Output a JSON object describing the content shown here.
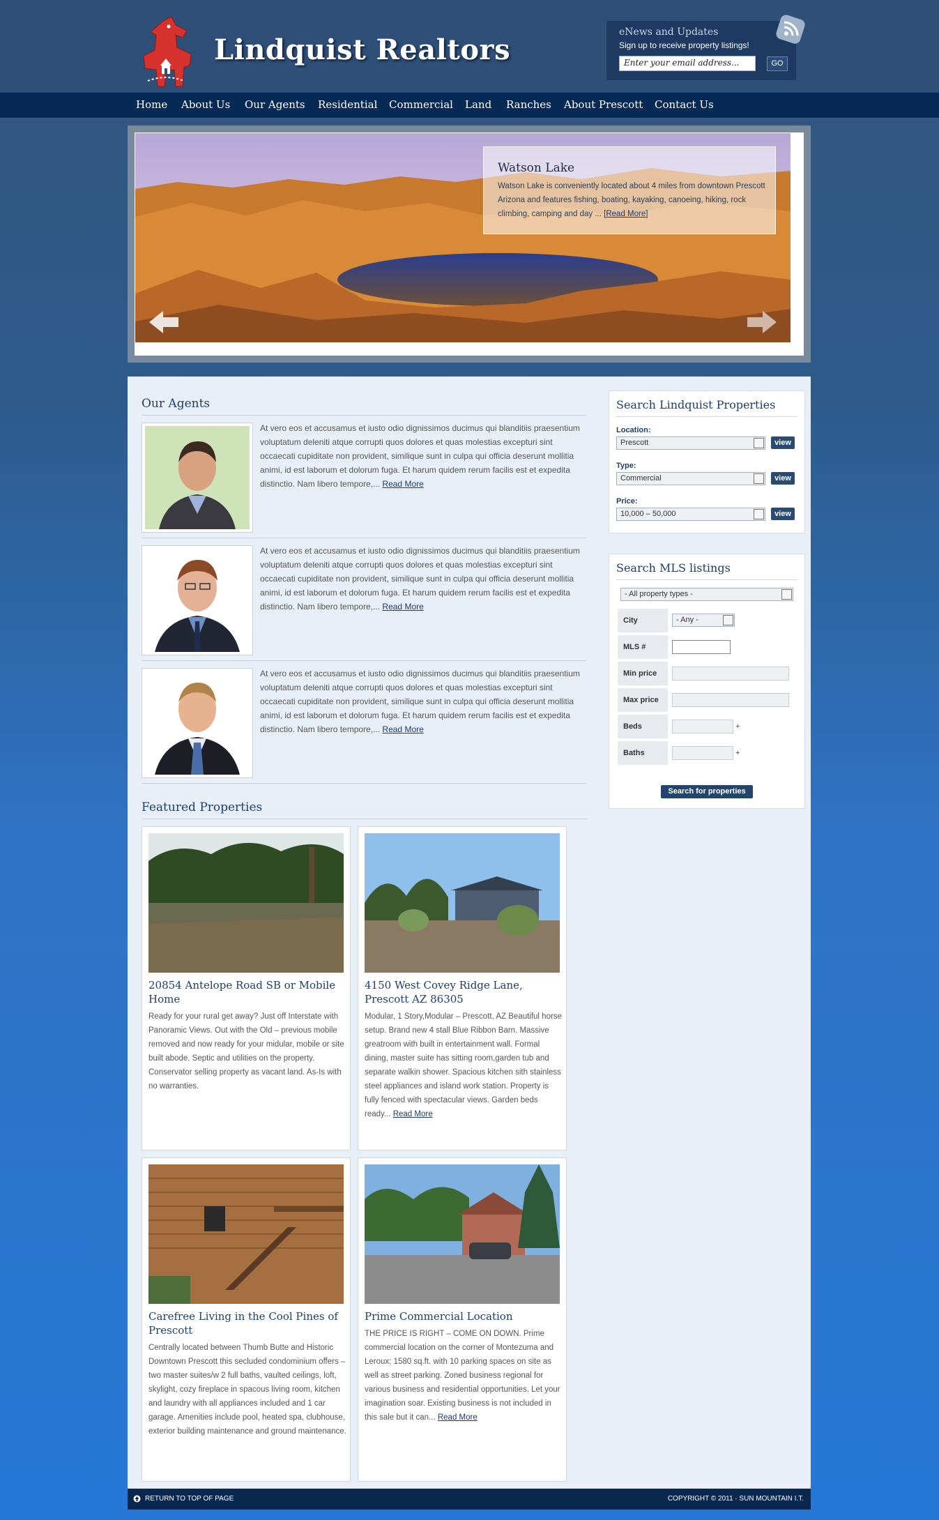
{
  "header": {
    "site_title": "Lindquist Realtors",
    "enews": {
      "title": "eNews and Updates",
      "subtitle": "Sign up to receive property listings!",
      "email_placeholder": "Enter your email address...",
      "go_label": "GO"
    }
  },
  "nav": {
    "items": [
      {
        "label": "Home"
      },
      {
        "label": "About Us"
      },
      {
        "label": "Our Agents"
      },
      {
        "label": "Residential"
      },
      {
        "label": "Commercial"
      },
      {
        "label": "Land"
      },
      {
        "label": "Ranches"
      },
      {
        "label": "About Prescott"
      },
      {
        "label": "Contact Us"
      }
    ]
  },
  "slider": {
    "title": "Watson Lake",
    "text": "Watson Lake is conveniently located about 4 miles from downtown Prescott Arizona and features fishing, boating, kayaking, canoeing, hiking, rock climbing, camping and day ...",
    "link": "[Read More]"
  },
  "agents": {
    "title": "Our Agents",
    "items": [
      {
        "text": "At vero eos et accusamus et iusto odio dignissimos ducimus qui blanditiis praesentium voluptatum deleniti atque corrupti quos dolores et quas molestias excepturi sint occaecati cupiditate non provident, similique sunt in culpa qui officia deserunt mollitia animi, id est laborum et dolorum fuga. Et harum quidem rerum facilis est et expedita distinctio. Nam libero tempore,...",
        "link": "Read More"
      },
      {
        "text": "At vero eos et accusamus et iusto odio dignissimos ducimus qui blanditiis praesentium voluptatum deleniti atque corrupti quos dolores et quas molestias excepturi sint occaecati cupiditate non provident, similique sunt in culpa qui officia deserunt mollitia animi, id est laborum et dolorum fuga. Et harum quidem rerum facilis est et expedita distinctio. Nam libero tempore,...",
        "link": "Read More"
      },
      {
        "text": "At vero eos et accusamus et iusto odio dignissimos ducimus qui blanditiis praesentium voluptatum deleniti atque corrupti quos dolores et quas molestias excepturi sint occaecati cupiditate non provident, similique sunt in culpa qui officia deserunt mollitia animi, id est laborum et dolorum fuga. Et harum quidem rerum facilis est et expedita distinctio. Nam libero tempore,...",
        "link": "Read More"
      }
    ]
  },
  "featured": {
    "title": "Featured Properties",
    "items": [
      {
        "title": "20854 Antelope Road SB or Mobile Home",
        "text": "Ready for your rural get away? Just off Interstate with Panoramic Views. Out with the Old – previous mobile removed and now ready for your midular, mobile or site built abode. Septic and utilities on the property. Conservator selling property as vacant land. As-Is with no warranties.",
        "link": ""
      },
      {
        "title": "4150 West Covey Ridge Lane, Prescott AZ 86305",
        "text": "Modular, 1 Story,Modular – Prescott, AZ Beautiful horse setup. Brand new 4 stall Blue Ribbon Barn. Massive greatroom with built in entertainment wall. Formal dining, master suite has sitting room,garden tub and separate walkin shower. Spacious kitchen sith stainless steel appliances and island work station. Property is fully fenced with spectacular views. Garden beds ready...",
        "link": "Read More"
      },
      {
        "title": "Carefree Living in the Cool Pines of Prescott",
        "text": "Centrally located between Thumb Butte and Historic Downtown Prescott this secluded condominium offers – two master suites/w 2 full baths, vaulted ceilings, loft, skylight, cozy fireplace in spacous living room, kitchen and laundry with all appliances included and 1 car garage. Amenities include pool, heated spa, clubhouse, exterior building maintenance and ground maintenance.",
        "link": ""
      },
      {
        "title": "Prime Commercial Location",
        "text": "THE PRICE IS RIGHT – COME ON DOWN. Prime commercial location on the corner of Montezuma and Leroux; 1580 sq.ft. with 10 parking spaces on site as well as street parking. Zoned business regional for various business and residential opportunities. Let your imagination soar. Existing business is not included in this sale but it can...",
        "link": "Read More"
      }
    ]
  },
  "search_properties": {
    "title": "Search Lindquist Properties",
    "location_label": "Location:",
    "location_value": "Prescott",
    "type_label": "Type:",
    "type_value": "Commercial",
    "price_label": "Price:",
    "price_value": "10,000 – 50,000",
    "view_label": "view"
  },
  "mls": {
    "title": "Search MLS listings",
    "property_type": "- All property types -",
    "city_label": "City",
    "city_value": "- Any -",
    "mls_label": "MLS #",
    "min_price_label": "Min price",
    "max_price_label": "Max price",
    "beds_label": "Beds",
    "baths_label": "Baths",
    "plus": "+",
    "search_button": "Search for properties"
  },
  "footer": {
    "return_label": "Return to top of page",
    "copyright": "Copyright © 2011 · Sun Mountain I.T."
  },
  "colors": {
    "nav_bg": "#062a55",
    "accent": "#1c3f6e",
    "horse_red": "#d7332e"
  }
}
